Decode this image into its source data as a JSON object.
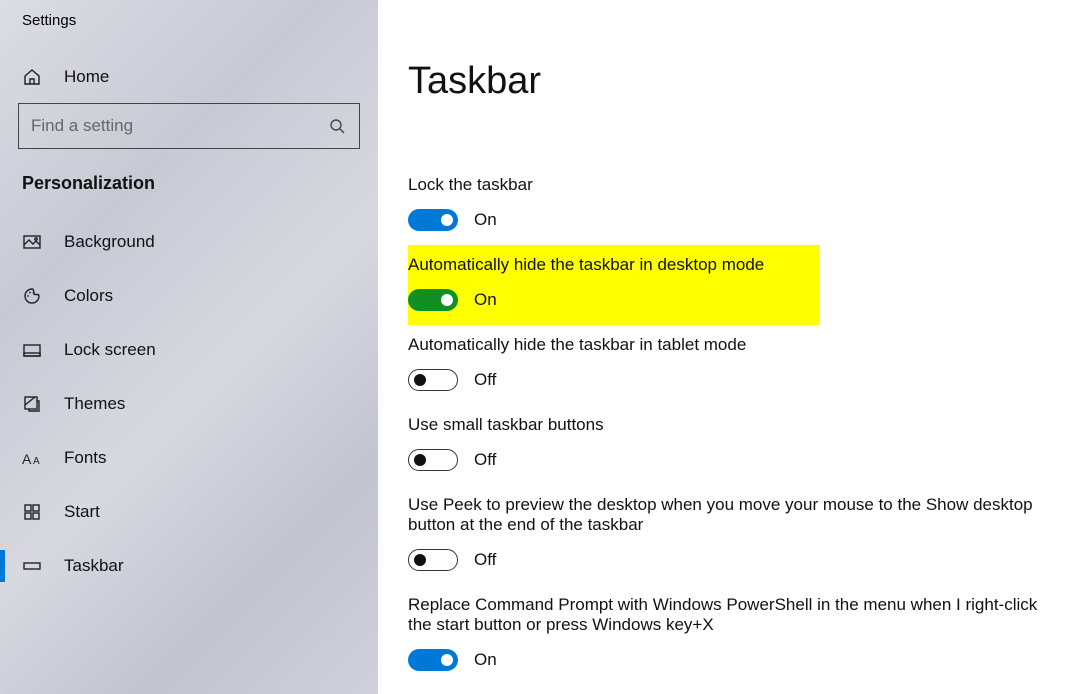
{
  "sidebar": {
    "title": "Settings",
    "home": "Home",
    "search_placeholder": "Find a setting",
    "category": "Personalization",
    "items": [
      {
        "icon": "background",
        "label": "Background"
      },
      {
        "icon": "colors",
        "label": "Colors"
      },
      {
        "icon": "lockscreen",
        "label": "Lock screen"
      },
      {
        "icon": "themes",
        "label": "Themes"
      },
      {
        "icon": "fonts",
        "label": "Fonts"
      },
      {
        "icon": "start",
        "label": "Start"
      },
      {
        "icon": "taskbar",
        "label": "Taskbar"
      }
    ],
    "selected": "Taskbar"
  },
  "main": {
    "title": "Taskbar",
    "settings": [
      {
        "label": "Lock the taskbar",
        "state": "On",
        "style": "on-blue",
        "highlight": false
      },
      {
        "label": "Automatically hide the taskbar in desktop mode",
        "state": "On",
        "style": "on-green",
        "highlight": true
      },
      {
        "label": "Automatically hide the taskbar in tablet mode",
        "state": "Off",
        "style": "off",
        "highlight": false
      },
      {
        "label": "Use small taskbar buttons",
        "state": "Off",
        "style": "off",
        "highlight": false
      },
      {
        "label": "Use Peek to preview the desktop when you move your mouse to the Show desktop button at the end of the taskbar",
        "state": "Off",
        "style": "off",
        "highlight": false
      },
      {
        "label": "Replace Command Prompt with Windows PowerShell in the menu when I right-click the start button or press Windows key+X",
        "state": "On",
        "style": "on-blue",
        "highlight": false
      }
    ]
  }
}
